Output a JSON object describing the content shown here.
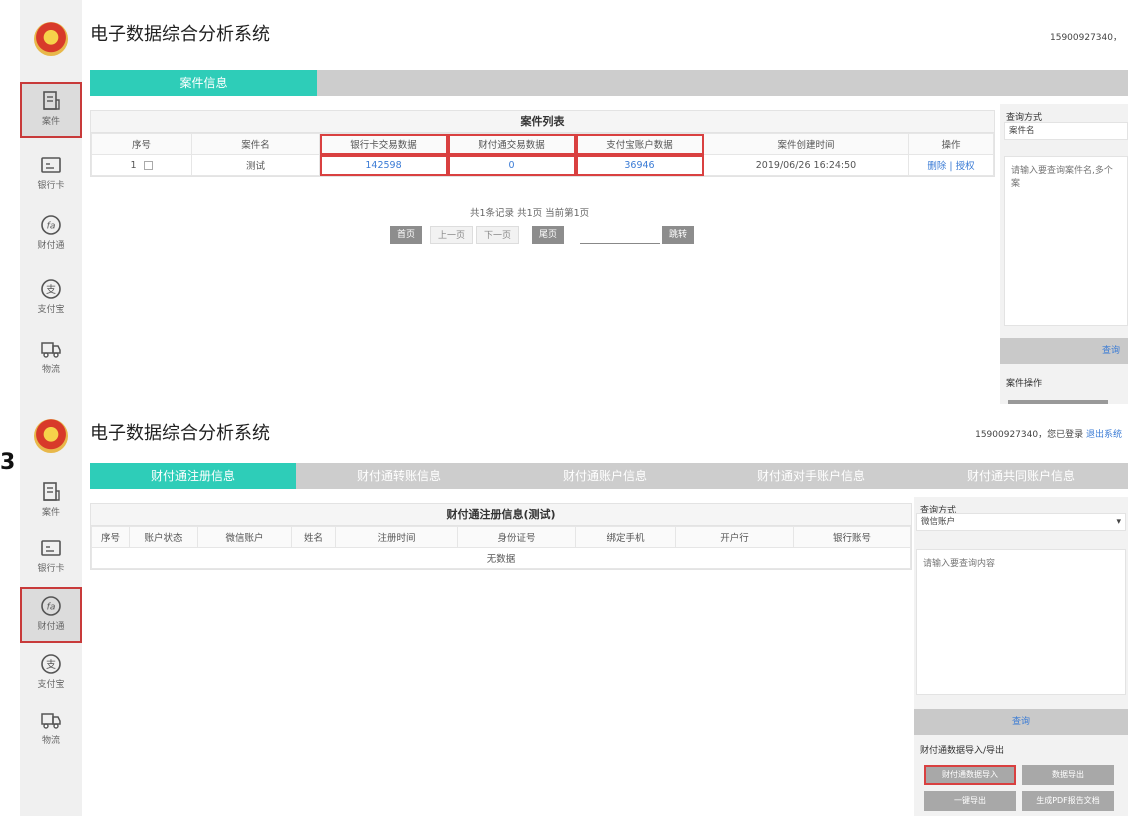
{
  "side_number": "3",
  "shot1": {
    "app_title": "电子数据综合分析系统",
    "user_line": "15900927340，",
    "nav": [
      {
        "label": "案件",
        "icon": "case-icon"
      },
      {
        "label": "银行卡",
        "icon": "bank-card-icon"
      },
      {
        "label": "财付通",
        "icon": "tenpay-icon"
      },
      {
        "label": "支付宝",
        "icon": "alipay-icon"
      },
      {
        "label": "物流",
        "icon": "logistics-truck-icon"
      }
    ],
    "tabs": [
      "案件信息"
    ],
    "table": {
      "caption": "案件列表",
      "headers": [
        "序号",
        "案件名",
        "银行卡交易数据",
        "财付通交易数据",
        "支付宝账户数据",
        "案件创建时间",
        "操作"
      ],
      "rows": [
        {
          "index": "1",
          "name": "测试",
          "bank": "142598",
          "tenpay": "0",
          "alipay": "36946",
          "created": "2019/06/26 16:24:50",
          "delete": "删除",
          "sep": "|",
          "grant": "授权"
        }
      ]
    },
    "pager": {
      "info": "共1条记录 共1页 当前第1页",
      "first": "首页",
      "prev": "上一页",
      "next": "下一页",
      "last": "尾页",
      "jump": "跳转"
    },
    "right": {
      "query_label": "查询方式",
      "query_value": "案件名",
      "placeholder": "请输入要查询案件名,多个案",
      "query_button": "查询",
      "ops_label": "案件操作"
    }
  },
  "shot2": {
    "app_title": "电子数据综合分析系统",
    "user_phone": "15900927340，",
    "user_logged": "您已登录",
    "logout": "退出系统",
    "nav": [
      {
        "label": "案件",
        "icon": "case-icon"
      },
      {
        "label": "银行卡",
        "icon": "bank-card-icon"
      },
      {
        "label": "财付通",
        "icon": "tenpay-icon"
      },
      {
        "label": "支付宝",
        "icon": "alipay-icon"
      },
      {
        "label": "物流",
        "icon": "logistics-truck-icon"
      }
    ],
    "tabs": [
      "财付通注册信息",
      "财付通转账信息",
      "财付通账户信息",
      "财付通对手账户信息",
      "财付通共同账户信息"
    ],
    "table": {
      "caption": "财付通注册信息(测试)",
      "headers": [
        "序号",
        "账户状态",
        "微信账户",
        "姓名",
        "注册时间",
        "身份证号",
        "绑定手机",
        "开户行",
        "银行账号"
      ],
      "empty": "无数据"
    },
    "right": {
      "query_label": "查询方式",
      "query_value": "微信账户",
      "placeholder": "请输入要查询内容",
      "query_button": "查询",
      "ops_label": "财付通数据导入/导出",
      "btn_import": "财付通数据导入",
      "btn_export": "数据导出",
      "btn_oneclick": "一键导出",
      "btn_pdf": "生成PDF报告文档"
    }
  }
}
